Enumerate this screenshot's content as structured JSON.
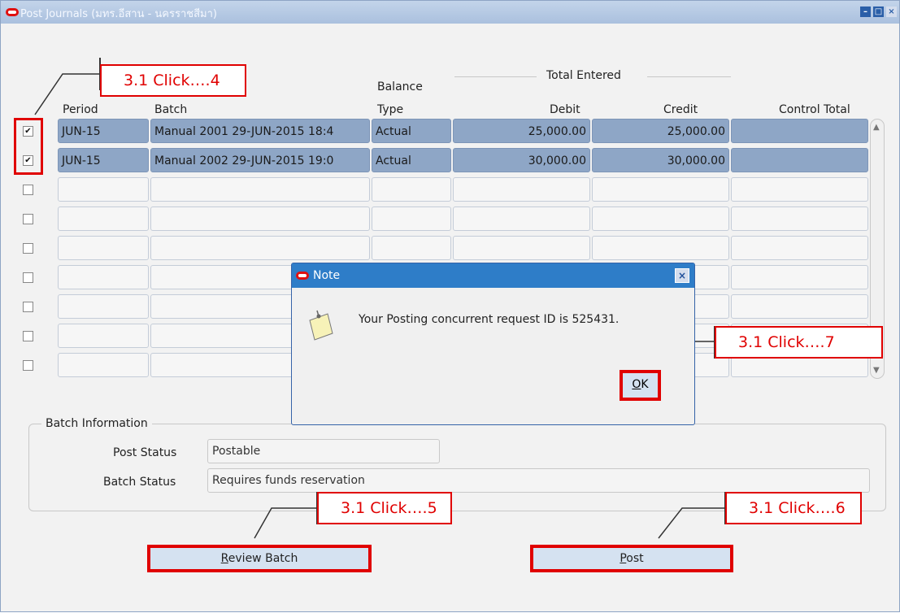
{
  "window": {
    "title": "Post Journals (มทร.อีสาน - นครราชสีมา)"
  },
  "table": {
    "group_header": "Total Entered",
    "columns": {
      "period": "Period",
      "batch": "Batch",
      "balance_type_1": "Balance",
      "balance_type_2": "Type",
      "debit": "Debit",
      "credit": "Credit",
      "control_total": "Control Total"
    },
    "rows": [
      {
        "checked": true,
        "period": "JUN-15",
        "batch": "Manual 2001 29-JUN-2015 18:4",
        "balance_type": "Actual",
        "debit": "25,000.00",
        "credit": "25,000.00",
        "control_total": ""
      },
      {
        "checked": true,
        "period": "JUN-15",
        "batch": "Manual 2002 29-JUN-2015 19:0",
        "balance_type": "Actual",
        "debit": "30,000.00",
        "credit": "30,000.00",
        "control_total": ""
      },
      {
        "checked": false
      },
      {
        "checked": false
      },
      {
        "checked": false
      },
      {
        "checked": false
      },
      {
        "checked": false
      },
      {
        "checked": false
      },
      {
        "checked": false
      }
    ]
  },
  "batch_info": {
    "title": "Batch Information",
    "post_status_label": "Post Status",
    "post_status": "Postable",
    "batch_status_label": "Batch Status",
    "batch_status": "Requires funds reservation"
  },
  "buttons": {
    "review_batch_mnemonic": "R",
    "review_batch_rest": "eview Batch",
    "post_mnemonic": "P",
    "post_rest": "ost"
  },
  "dialog": {
    "title": "Note",
    "message": "Your Posting concurrent request ID is 525431.",
    "ok_mnemonic": "O",
    "ok_rest": "K"
  },
  "callouts": {
    "c4": "3.1 Click….4",
    "c5": "3.1 Click….5",
    "c6": "3.1 Click….6",
    "c7": "3.1 Click….7"
  },
  "icons": {
    "app": "oracle-logo-icon",
    "note": "note-icon",
    "check": "✔"
  },
  "colors": {
    "accent_red": "#e00000",
    "selected_row": "#8ea6c6",
    "title_bar": "#2e7dc8"
  }
}
